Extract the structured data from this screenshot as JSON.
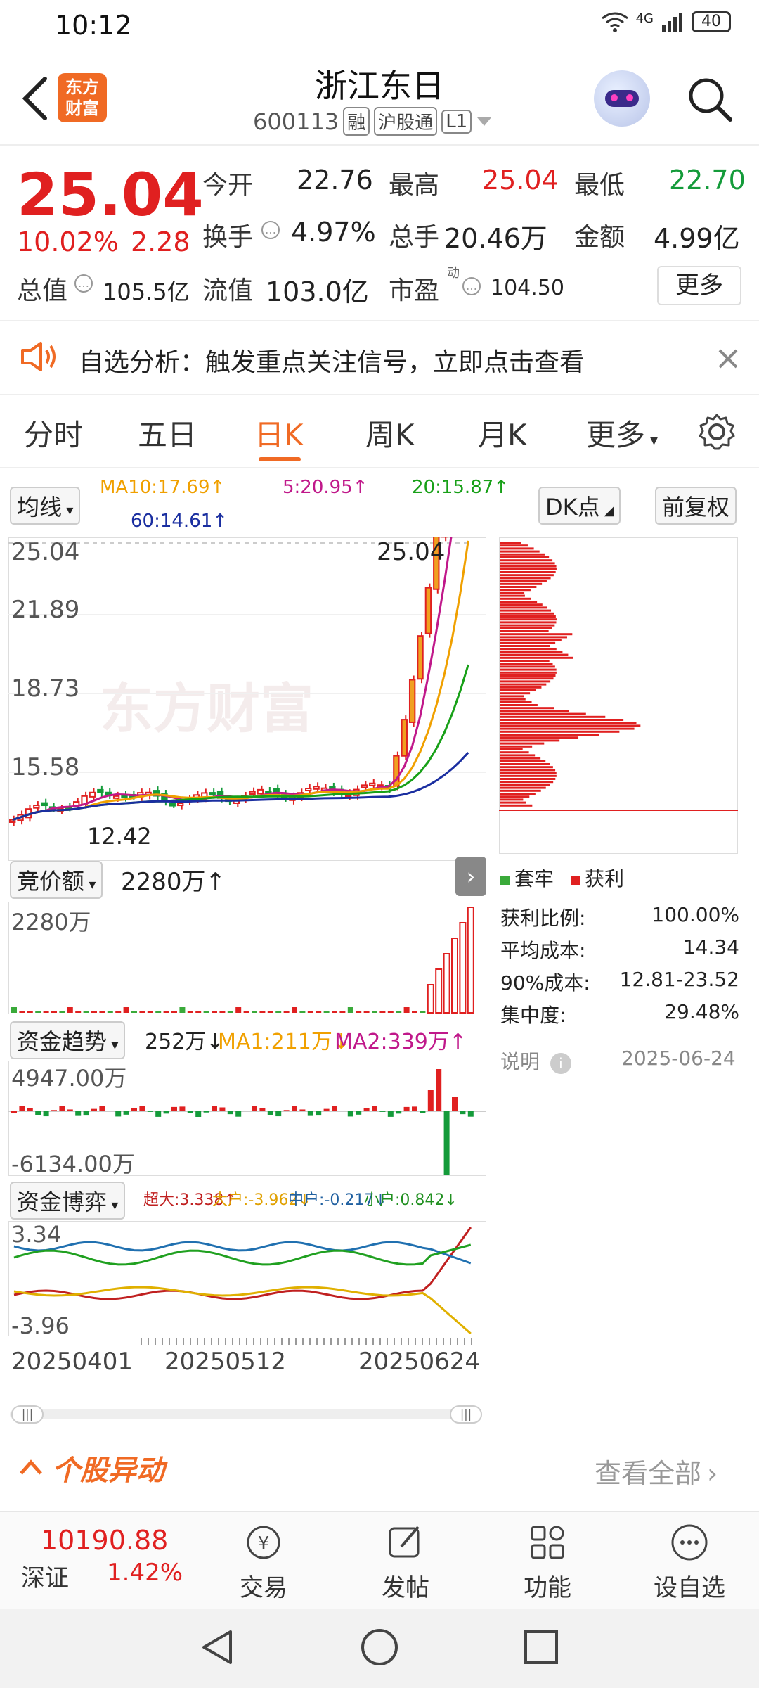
{
  "status": {
    "time": "10:12",
    "net": "4G",
    "battery": "40"
  },
  "header": {
    "logo_line1": "东方",
    "logo_line2": "财富",
    "title": "浙江东日",
    "code": "600113",
    "tags": [
      "融",
      "沪股通",
      "L1"
    ]
  },
  "quote": {
    "price": "25.04",
    "pct": "10.02%",
    "change": "2.28",
    "open_label": "今开",
    "open": "22.76",
    "high_label": "最高",
    "high": "25.04",
    "low_label": "最低",
    "low": "22.70",
    "turnover_label": "换手",
    "turnover": "4.97%",
    "volume_label": "总手",
    "volume": "20.46万",
    "amount_label": "金额",
    "amount": "4.99亿",
    "mktcap_label": "总值",
    "mktcap": "105.5亿",
    "float_label": "流值",
    "float": "103.0亿",
    "pe_label": "市盈",
    "pe_sup": "动",
    "pe": "104.50",
    "more": "更多"
  },
  "banner": {
    "text": "自选分析：触发重点关注信号，立即点击查看"
  },
  "tabs": [
    "分时",
    "五日",
    "日K",
    "周K",
    "月K",
    "更多"
  ],
  "active_tab": "日K",
  "kline": {
    "ma_select": "均线",
    "ma10": "MA10:17.69↑",
    "ma5": "5:20.95↑",
    "ma20": "20:15.87↑",
    "ma60": "60:14.61↑",
    "dk": "DK点",
    "adjust": "前复权",
    "y_labels": [
      "25.04",
      "21.89",
      "18.73",
      "15.58",
      "12.42"
    ],
    "current": "25.04",
    "low_mark": "12.42",
    "watermark": "东方财富",
    "colors": {
      "up": "#e02020",
      "down": "#149b3a",
      "ma5": "#c0188a",
      "ma10": "#f0a000",
      "ma20": "#18a018",
      "ma60": "#1a2ea0"
    }
  },
  "auction": {
    "select": "竞价额",
    "value": "2280万↑",
    "max": "2280万"
  },
  "flow": {
    "select": "资金趋势",
    "value": "252万↓",
    "ma1": "MA1:211万↓",
    "ma2": "MA2:339万↑",
    "max": "4947.00万",
    "min": "-6134.00万"
  },
  "game": {
    "select": "资金博弈",
    "super": "超大:3.338↑",
    "large": "大户:-3.962↓",
    "mid": "中户:-0.217↓",
    "small": "小户:0.842↓",
    "max": "3.34",
    "min": "-3.96"
  },
  "dates": [
    "20250401",
    "20250512",
    "20250624"
  ],
  "chip": {
    "legend_trap": "套牢",
    "legend_profit": "获利",
    "rows": [
      {
        "label": "获利比例:",
        "value": "100.00%"
      },
      {
        "label": "平均成本:",
        "value": "14.34"
      },
      {
        "label": "90%成本:",
        "value": "12.81-23.52"
      },
      {
        "label": "集中度:",
        "value": "29.48%"
      }
    ],
    "note": "说明",
    "date": "2025-06-24"
  },
  "movement": {
    "title": "个股异动",
    "view_all": "查看全部"
  },
  "bottom": {
    "index_value": "10190.88",
    "index_name": "深证",
    "index_pct": "1.42%",
    "items": [
      "交易",
      "发帖",
      "功能",
      "设自选"
    ]
  }
}
